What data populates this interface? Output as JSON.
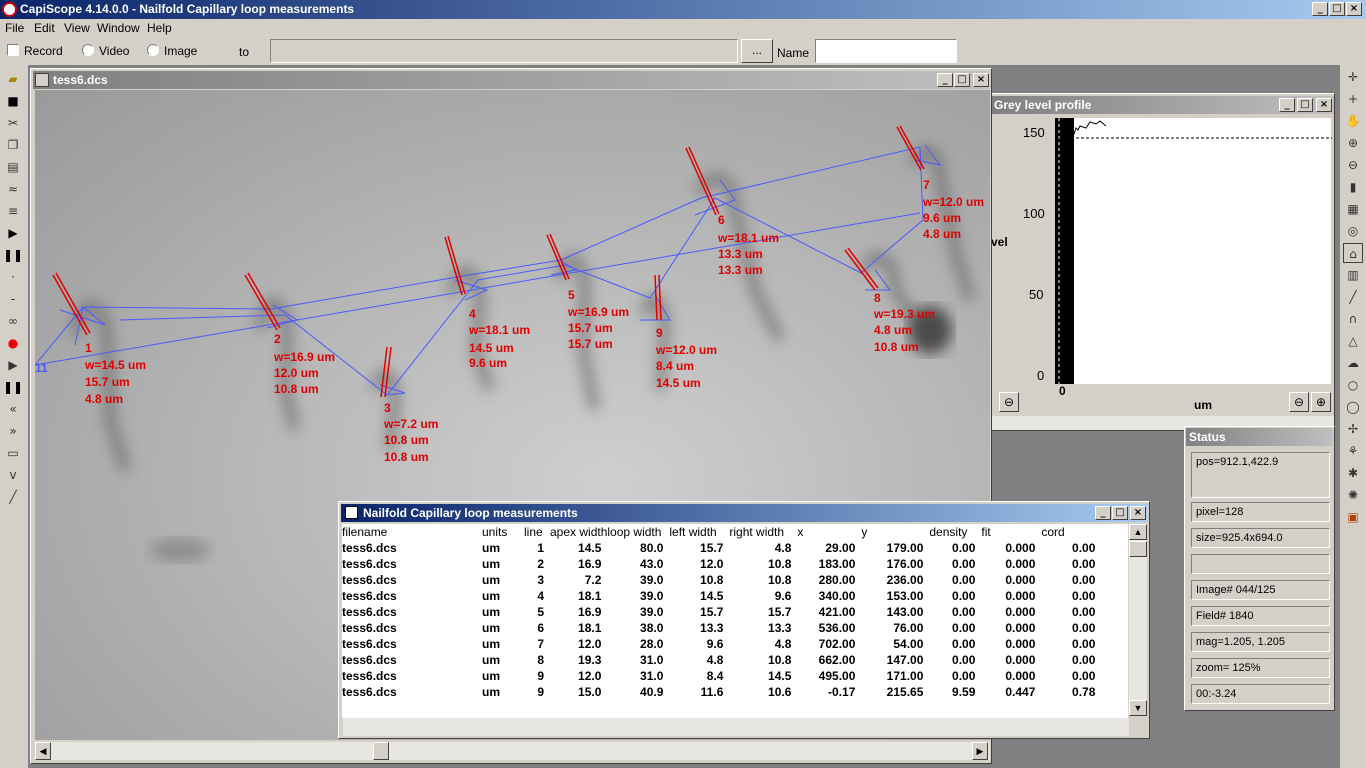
{
  "app": {
    "title": "CapiScope 4.14.0.0 - Nailfold Capillary loop measurements"
  },
  "menu": [
    "File",
    "Edit",
    "View",
    "Window",
    "Help"
  ],
  "options": {
    "record": "Record",
    "video": "Video",
    "image": "Image",
    "to": "to",
    "browse": "...",
    "name_label": "Name",
    "path_value": "",
    "name_value": ""
  },
  "image_window": {
    "title": "tess6.dcs"
  },
  "loops": [
    {
      "n": "1",
      "w": "w=14.5 um",
      "l": "15.7 um",
      "r": "4.8 um"
    },
    {
      "n": "2",
      "w": "w=16.9 um",
      "l": "12.0 um",
      "r": "10.8 um"
    },
    {
      "n": "3",
      "w": "w=7.2 um",
      "l": "10.8 um",
      "r": "10.8 um"
    },
    {
      "n": "4",
      "w": "w=18.1 um",
      "l": "14.5 um",
      "r": "9.6 um"
    },
    {
      "n": "5",
      "w": "w=16.9 um",
      "l": "15.7 um",
      "r": "15.7 um"
    },
    {
      "n": "6",
      "w": "w=18.1 um",
      "l": "13.3 um",
      "r": "13.3 um"
    },
    {
      "n": "7",
      "w": "w=12.0 um",
      "l": "9.6 um",
      "r": "4.8 um"
    },
    {
      "n": "8",
      "w": "w=19.3 um",
      "l": "4.8 um",
      "r": "10.8 um"
    },
    {
      "n": "9",
      "w": "w=12.0 um",
      "l": "8.4 um",
      "r": "14.5 um"
    }
  ],
  "extra_label": "11",
  "grey_profile": {
    "title": "Grey level profile",
    "y_ticks": [
      "150",
      "100",
      "50",
      "0"
    ],
    "ylabel": "vel",
    "xlabel": "um",
    "x_tick": "0"
  },
  "status": {
    "title": "Status",
    "fields": [
      "pos=912.1,422.9",
      "",
      "pixel=128",
      "size=925.4x694.0",
      "",
      "Image# 044/125",
      "Field# 1840",
      "mag=1.205, 1.205",
      "zoom= 125%",
      "00:-3.24"
    ]
  },
  "measurements": {
    "title": "Nailfold Capillary loop measurements",
    "columns": [
      "filename",
      "units",
      "line",
      "apex width",
      "loop width",
      "left width",
      "right width",
      "x",
      "y",
      "density",
      "fit",
      "cord"
    ],
    "rows": [
      [
        "tess6.dcs",
        "um",
        "1",
        "14.5",
        "80.0",
        "15.7",
        "4.8",
        "29.00",
        "179.00",
        "0.00",
        "0.000",
        "0.00"
      ],
      [
        "tess6.dcs",
        "um",
        "2",
        "16.9",
        "43.0",
        "12.0",
        "10.8",
        "183.00",
        "176.00",
        "0.00",
        "0.000",
        "0.00"
      ],
      [
        "tess6.dcs",
        "um",
        "3",
        "7.2",
        "39.0",
        "10.8",
        "10.8",
        "280.00",
        "236.00",
        "0.00",
        "0.000",
        "0.00"
      ],
      [
        "tess6.dcs",
        "um",
        "4",
        "18.1",
        "39.0",
        "14.5",
        "9.6",
        "340.00",
        "153.00",
        "0.00",
        "0.000",
        "0.00"
      ],
      [
        "tess6.dcs",
        "um",
        "5",
        "16.9",
        "39.0",
        "15.7",
        "15.7",
        "421.00",
        "143.00",
        "0.00",
        "0.000",
        "0.00"
      ],
      [
        "tess6.dcs",
        "um",
        "6",
        "18.1",
        "38.0",
        "13.3",
        "13.3",
        "536.00",
        "76.00",
        "0.00",
        "0.000",
        "0.00"
      ],
      [
        "tess6.dcs",
        "um",
        "7",
        "12.0",
        "28.0",
        "9.6",
        "4.8",
        "702.00",
        "54.00",
        "0.00",
        "0.000",
        "0.00"
      ],
      [
        "tess6.dcs",
        "um",
        "8",
        "19.3",
        "31.0",
        "4.8",
        "10.8",
        "662.00",
        "147.00",
        "0.00",
        "0.000",
        "0.00"
      ],
      [
        "tess6.dcs",
        "um",
        "9",
        "12.0",
        "31.0",
        "8.4",
        "14.5",
        "495.00",
        "171.00",
        "0.00",
        "0.000",
        "0.00"
      ],
      [
        "tess6.dcs",
        "um",
        "9",
        "15.0",
        "40.9",
        "11.6",
        "10.6",
        "-0.17",
        "215.65",
        "9.59",
        "0.447",
        "0.78"
      ]
    ]
  }
}
